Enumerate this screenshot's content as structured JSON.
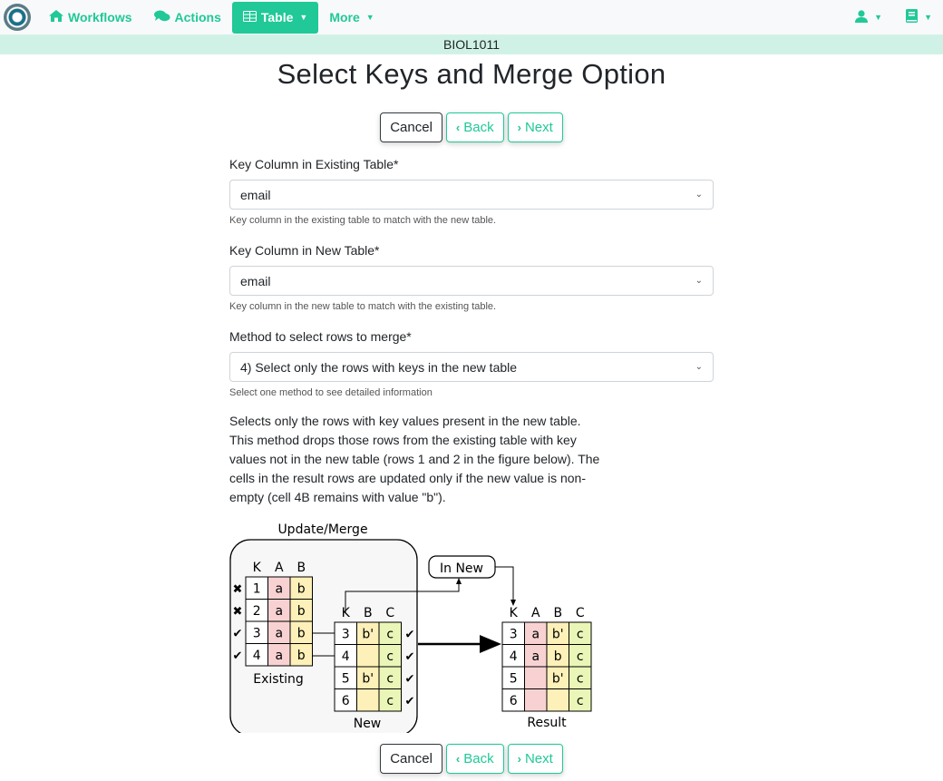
{
  "nav": {
    "workflows_label": "Workflows",
    "actions_label": "Actions",
    "table_label": "Table",
    "more_label": "More",
    "accent_color": "#20c997"
  },
  "course_name": "BIOL1011",
  "page_title": "Select Keys and Merge Option",
  "buttons": {
    "cancel": "Cancel",
    "back": "Back",
    "next": "Next"
  },
  "fields": {
    "existing_key": {
      "label": "Key Column in Existing Table*",
      "value": "email",
      "help": "Key column in the existing table to match with the new table."
    },
    "new_key": {
      "label": "Key Column in New Table*",
      "value": "email",
      "help": "Key column in the new table to match with the existing table."
    },
    "method": {
      "label": "Method to select rows to merge*",
      "value": "4) Select only the rows with keys in the new table",
      "help": "Select one method to see detailed information"
    }
  },
  "description": "Selects only the rows with key values present in the new table. This method drops those rows from the existing table with key values not in the new table (rows 1 and 2 in the figure below). The cells in the result rows are updated only if the new value is non-empty (cell 4B remains with value \"b\").",
  "figure": {
    "title": "Update/Merge",
    "in_new_label": "In New",
    "existing_label": "Existing",
    "new_label": "New",
    "result_label": "Result",
    "existing_headers": [
      "K",
      "A",
      "B"
    ],
    "existing_rows": [
      [
        "1",
        "a",
        "b"
      ],
      [
        "2",
        "a",
        "b"
      ],
      [
        "3",
        "a",
        "b"
      ],
      [
        "4",
        "a",
        "b"
      ]
    ],
    "existing_marks": [
      "✖",
      "✖",
      "✔",
      "✔"
    ],
    "new_headers": [
      "K",
      "B",
      "C"
    ],
    "new_rows": [
      [
        "3",
        "b'",
        "c"
      ],
      [
        "4",
        "",
        "c"
      ],
      [
        "5",
        "b'",
        "c"
      ],
      [
        "6",
        "",
        "c"
      ]
    ],
    "new_marks": [
      "✔",
      "✔",
      "✔",
      "✔"
    ],
    "result_headers": [
      "K",
      "A",
      "B",
      "C"
    ],
    "result_rows": [
      [
        "3",
        "a",
        "b'",
        "c"
      ],
      [
        "4",
        "a",
        "b",
        "c"
      ],
      [
        "5",
        "",
        "b'",
        "c"
      ],
      [
        "6",
        "",
        "",
        "c"
      ]
    ]
  }
}
